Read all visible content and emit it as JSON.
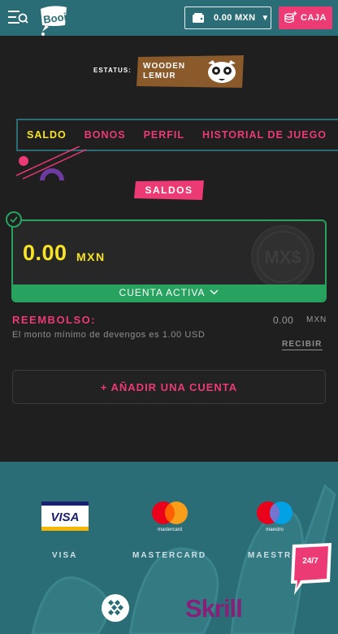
{
  "header": {
    "wallet_amount": "0.00 MXN",
    "caja_label": "CAJA",
    "logo_text": "Booi!"
  },
  "status": {
    "label": "ESTATUS:",
    "level_line1": "WOODEN",
    "level_line2": "LEMUR"
  },
  "tabs": [
    {
      "label": "SALDO",
      "active": true
    },
    {
      "label": "BONOS",
      "active": false
    },
    {
      "label": "PERFIL",
      "active": false
    },
    {
      "label": "HISTORIAL DE JUEGO",
      "active": false
    }
  ],
  "saldos_title": "SALDOS",
  "balance_card": {
    "amount": "0.00",
    "currency": "MXN",
    "coin_text": "MX$",
    "status_label": "CUENTA ACTIVA"
  },
  "reembolso": {
    "title": "REEMBOLSO:",
    "value": "0.00",
    "currency": "MXN",
    "description": "El monto mínimo de devengos es 1.00 USD",
    "action": "RECIBIR"
  },
  "add_account_label": "+ AÑADIR UNA CUENTA",
  "payments": {
    "methods": [
      {
        "name": "VISA",
        "logo_text": "VISA"
      },
      {
        "name": "MASTERCARD",
        "logo_text": "mastercard"
      },
      {
        "name": "MAESTRO",
        "logo_text": "maestro"
      }
    ],
    "bottom_logos": [
      "webmoney-icon",
      "Skrill"
    ]
  },
  "chat": {
    "label": "24/7"
  },
  "colors": {
    "teal": "#2b6d76",
    "pink": "#ec3a75",
    "yellow": "#f8e326",
    "green": "#27a35f",
    "background": "#1f1f1f"
  }
}
